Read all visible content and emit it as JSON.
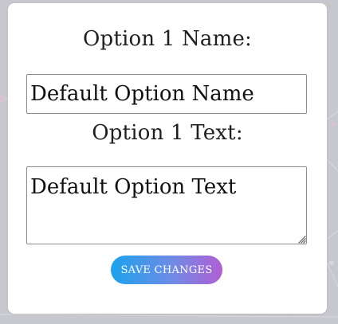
{
  "form": {
    "option_name_label": "Option 1 Name:",
    "option_name_value": "Default Option Name",
    "option_text_label": "Option 1 Text:",
    "option_text_value": "Default Option Text",
    "save_button_label": "SAVE CHANGES"
  },
  "colors": {
    "background": "#c7c8ce",
    "card": "#ffffff",
    "button_gradient_start": "#1aa3ec",
    "button_gradient_end": "#b05fd4"
  },
  "icons": {
    "textarea_corner": "resize-grip-icon"
  }
}
